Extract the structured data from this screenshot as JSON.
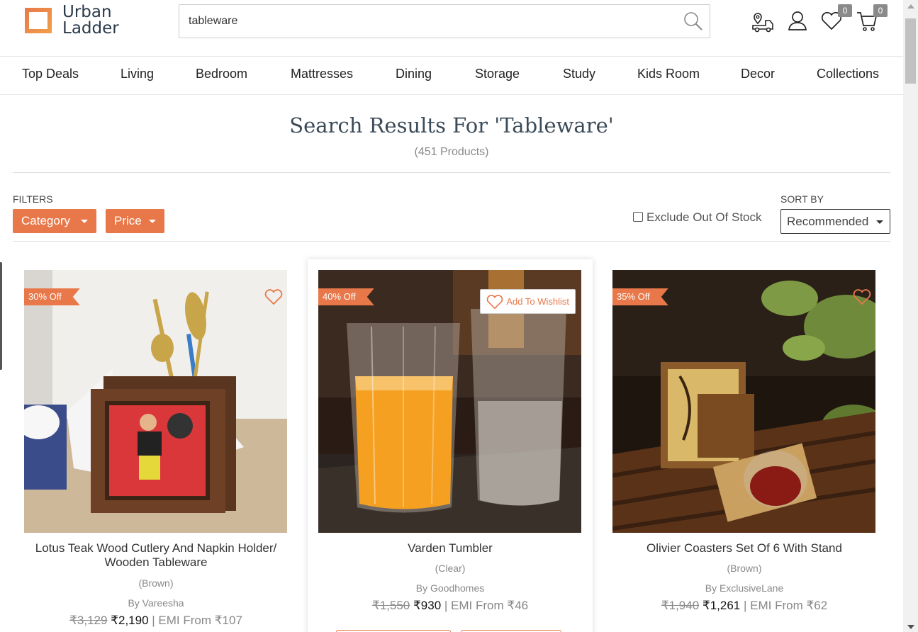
{
  "brand": {
    "line1": "Urban",
    "line2": "Ladder",
    "accent_color": "#e8784a",
    "text_color": "#2b3a4a"
  },
  "search": {
    "value": "tableware",
    "icon": "search-icon"
  },
  "header_icons": {
    "delivery": "delivery-truck-icon",
    "account": "user-icon",
    "wishlist": "heart-icon",
    "wishlist_count": "0",
    "cart": "cart-icon",
    "cart_count": "0"
  },
  "nav": [
    "Top Deals",
    "Living",
    "Bedroom",
    "Mattresses",
    "Dining",
    "Storage",
    "Study",
    "Kids Room",
    "Decor",
    "Collections"
  ],
  "results": {
    "title": "Search Results For 'Tableware'",
    "count": "(451 Products)"
  },
  "filters": {
    "label": "FILTERS",
    "category": "Category",
    "price": "Price",
    "exclude_out_of_stock": "Exclude Out Of Stock",
    "exclude_checked": false
  },
  "sort": {
    "label": "SORT BY",
    "selected": "Recommended"
  },
  "products": [
    {
      "discount": "30% Off",
      "name": "Lotus Teak Wood Cutlery And Napkin Holder/ Wooden Tableware",
      "variant": "(Brown)",
      "brand": "By Vareesha",
      "mrp": "₹3,129",
      "price": "₹2,190",
      "emi": "| EMI From ₹107"
    },
    {
      "discount": "40% Off",
      "wishlist_label": "Add To Wishlist",
      "name": "Varden Tumbler",
      "variant": "(Clear)",
      "brand": "By Goodhomes",
      "mrp": "₹1,550",
      "price": "₹930",
      "emi": "| EMI From ₹46"
    },
    {
      "discount": "35% Off",
      "name": "Olivier Coasters Set Of 6 With Stand",
      "variant": "(Brown)",
      "brand": "By ExclusiveLane",
      "mrp": "₹1,940",
      "price": "₹1,261",
      "emi": "| EMI From ₹62"
    }
  ]
}
